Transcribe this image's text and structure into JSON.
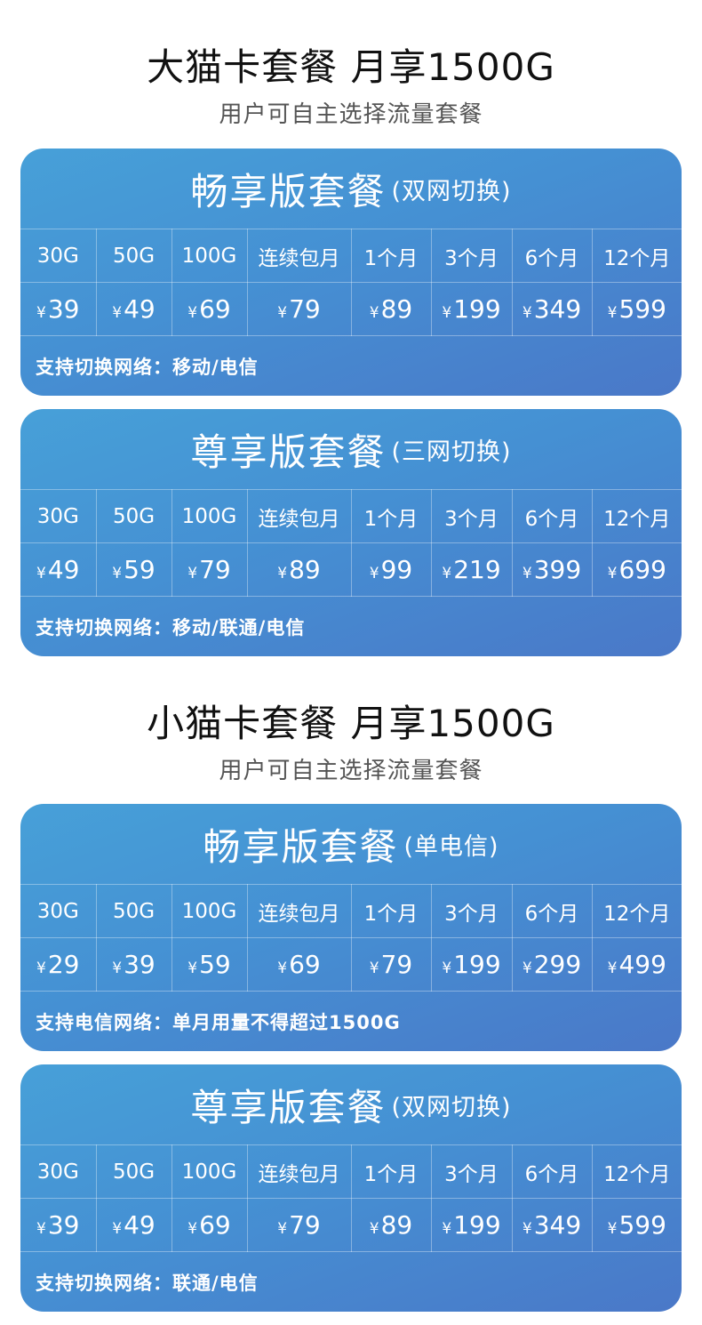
{
  "sections": [
    {
      "title": "大猫卡套餐 月享1500G",
      "subtitle": "用户可自主选择流量套餐",
      "cards": [
        {
          "title": "畅享版套餐",
          "note": "(双网切换)",
          "labels": [
            "30G",
            "50G",
            "100G",
            "连续包月",
            "1个月",
            "3个月",
            "6个月",
            "12个月"
          ],
          "prices": [
            "39",
            "49",
            "69",
            "79",
            "89",
            "199",
            "349",
            "599"
          ],
          "footer": "支持切换网络：移动/电信"
        },
        {
          "title": "尊享版套餐",
          "note": "(三网切换)",
          "labels": [
            "30G",
            "50G",
            "100G",
            "连续包月",
            "1个月",
            "3个月",
            "6个月",
            "12个月"
          ],
          "prices": [
            "49",
            "59",
            "79",
            "89",
            "99",
            "219",
            "399",
            "699"
          ],
          "footer": "支持切换网络：移动/联通/电信"
        }
      ]
    },
    {
      "title": "小猫卡套餐 月享1500G",
      "subtitle": "用户可自主选择流量套餐",
      "cards": [
        {
          "title": "畅享版套餐",
          "note": "(单电信)",
          "labels": [
            "30G",
            "50G",
            "100G",
            "连续包月",
            "1个月",
            "3个月",
            "6个月",
            "12个月"
          ],
          "prices": [
            "29",
            "39",
            "59",
            "69",
            "79",
            "199",
            "299",
            "499"
          ],
          "footer": "支持电信网络：单月用量不得超过1500G"
        },
        {
          "title": "尊享版套餐",
          "note": "(双网切换)",
          "labels": [
            "30G",
            "50G",
            "100G",
            "连续包月",
            "1个月",
            "3个月",
            "6个月",
            "12个月"
          ],
          "prices": [
            "39",
            "49",
            "69",
            "79",
            "89",
            "199",
            "349",
            "599"
          ],
          "footer": "支持切换网络：联通/电信"
        }
      ]
    }
  ],
  "currency_symbol": "¥"
}
